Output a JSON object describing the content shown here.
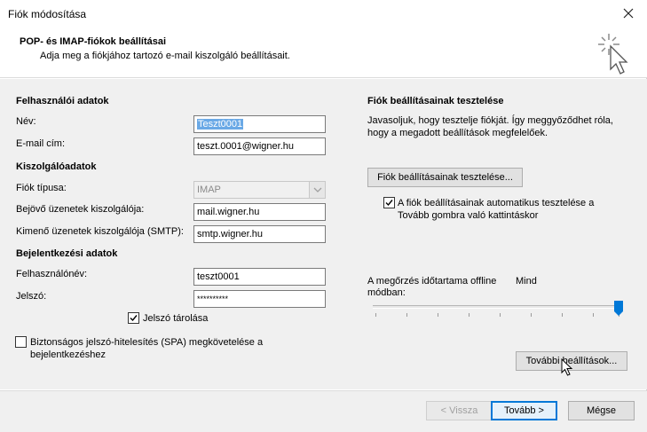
{
  "window": {
    "title": "Fiók módosítása"
  },
  "header": {
    "title": "POP- és IMAP-fiókok beállításai",
    "subtitle": "Adja meg a fiókjához tartozó e-mail kiszolgáló beállításait."
  },
  "user_info": {
    "section_title": "Felhasználói adatok",
    "name_label": "Név:",
    "name_value": "Teszt0001",
    "email_label": "E-mail cím:",
    "email_value": "teszt.0001@wigner.hu"
  },
  "server_info": {
    "section_title": "Kiszolgálóadatok",
    "account_type_label": "Fiók típusa:",
    "account_type_value": "IMAP",
    "incoming_label": "Bejövő üzenetek kiszolgálója:",
    "incoming_value": "mail.wigner.hu",
    "outgoing_label": "Kimenő üzenetek kiszolgálója (SMTP):",
    "outgoing_value": "smtp.wigner.hu"
  },
  "login_info": {
    "section_title": "Bejelentkezési adatok",
    "username_label": "Felhasználónév:",
    "username_value": "teszt0001",
    "password_label": "Jelszó:",
    "password_value": "**********",
    "remember_label": "Jelszó tárolása",
    "remember_checked": true,
    "spa_label_line1": "Biztonságos jelszó-hitelesítés (SPA) megkövetelése a",
    "spa_label_line2": "bejelentkezéshez",
    "spa_checked": false
  },
  "test": {
    "section_title": "Fiók beállításainak tesztelése",
    "desc_line1": "Javasoljuk, hogy tesztelje fiókját. Így meggyőződhet róla,",
    "desc_line2": "hogy a megadott beállítások megfelelőek.",
    "test_button": "Fiók beállításainak tesztelése...",
    "auto_test_line1": "A fiók beállításainak automatikus tesztelése a",
    "auto_test_line2": "Tovább gombra való kattintáskor",
    "auto_test_checked": true
  },
  "offline": {
    "label_line1": "A megőrzés időtartama offline",
    "label_line2": "módban:",
    "value": "Mind"
  },
  "more_settings_button": "További beállítások...",
  "footer": {
    "back_button": "< Vissza",
    "next_button": "Tovább >",
    "cancel_button": "Mégse"
  },
  "icons": {
    "close": "close-icon",
    "header": "cursor-sparkle-icon",
    "combo": "chevron-down-icon",
    "check": "checkmark-icon",
    "mouse": "mouse-pointer-icon"
  }
}
